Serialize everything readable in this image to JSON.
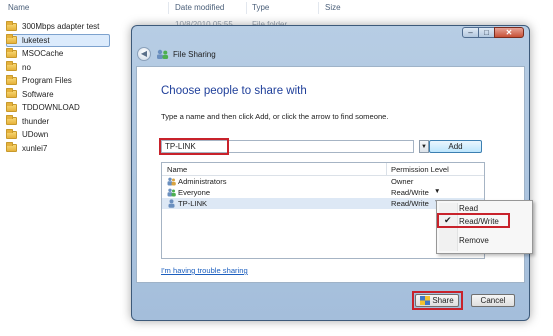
{
  "explorer": {
    "columns": {
      "name": "Name",
      "date": "Date modified",
      "type": "Type",
      "size": "Size"
    },
    "partial_row": {
      "date": "10/8/2010 05:55",
      "type": "File folder"
    },
    "items": [
      {
        "name": "300Mbps adapter test",
        "icon": "folder-icon"
      },
      {
        "name": "luketest",
        "icon": "folder-icon",
        "selected": true
      },
      {
        "name": "MSOCache",
        "icon": "folder-icon"
      },
      {
        "name": "no",
        "icon": "folder-icon"
      },
      {
        "name": "Program Files",
        "icon": "folder-icon"
      },
      {
        "name": "Software",
        "icon": "folder-icon"
      },
      {
        "name": "TDDOWNLOAD",
        "icon": "folder-icon"
      },
      {
        "name": "thunder",
        "icon": "folder-icon"
      },
      {
        "name": "UDown",
        "icon": "folder-icon"
      },
      {
        "name": "xunlei7",
        "icon": "folder-icon"
      }
    ]
  },
  "dialog": {
    "title": "File Sharing",
    "caption": {
      "minimize": "–",
      "maximize": "□",
      "close": "✕"
    },
    "back_glyph": "◀",
    "heading": "Choose people to share with",
    "instructions": "Type a name and then click Add, or click the arrow to find someone.",
    "input_value": "TP-LINK",
    "dropdown_glyph": "▼",
    "add_label": "Add",
    "grid": {
      "col_name": "Name",
      "col_perm": "Permission Level",
      "rows": [
        {
          "name": "Administrators",
          "permission": "Owner",
          "arrow": "",
          "icon": "users-icon"
        },
        {
          "name": "Everyone",
          "permission": "Read/Write",
          "arrow": "▼",
          "icon": "users-icon"
        },
        {
          "name": "TP-LINK",
          "permission": "Read/Write",
          "arrow": "▼",
          "icon": "user-icon",
          "selected": true
        }
      ]
    },
    "trouble_link": "I'm having trouble sharing",
    "share_label": "Share",
    "cancel_label": "Cancel"
  },
  "permission_menu": {
    "items": [
      "Read",
      "Read/Write",
      "Remove"
    ],
    "checked": "Read/Write",
    "check_glyph": "✔"
  },
  "colors": {
    "highlight": "#c8222b",
    "heading": "#1f3f9a",
    "link": "#1c5fbf",
    "selection": "#dde8f5"
  }
}
